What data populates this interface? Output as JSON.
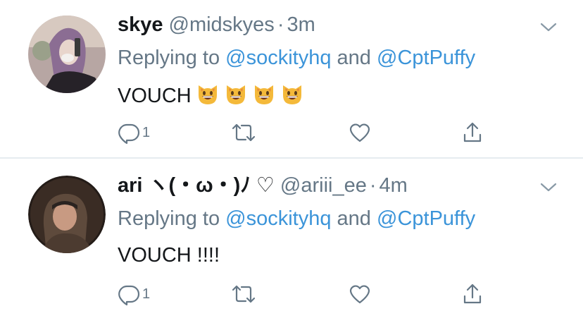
{
  "tweets": [
    {
      "display_name": "skye",
      "handle": "@midskyes",
      "separator": "·",
      "time": "3m",
      "reply_prefix": "Replying to",
      "mention_1": "@sockityhq",
      "reply_and": "and",
      "mention_2": "@CptPuffy",
      "text": "VOUCH",
      "emoji_count": 4,
      "emoji_icon": "grinning-cat-icon",
      "reply_count": "1"
    },
    {
      "display_name": "ari ヽ(・ω・)ﾉ ♡",
      "handle": "@ariii_ee",
      "separator": "·",
      "time": "4m",
      "reply_prefix": "Replying to",
      "mention_1": "@sockityhq",
      "reply_and": "and",
      "mention_2": "@CptPuffy",
      "text": "VOUCH !!!!",
      "reply_count": "1"
    }
  ],
  "icons": {
    "reply": "reply-icon",
    "retweet": "retweet-icon",
    "like": "heart-icon",
    "share": "share-icon",
    "menu": "chevron-down-icon"
  },
  "colors": {
    "link": "#3b94d9",
    "secondary_text": "#657786",
    "primary_text": "#14171a",
    "divider": "#e6ecf0"
  }
}
